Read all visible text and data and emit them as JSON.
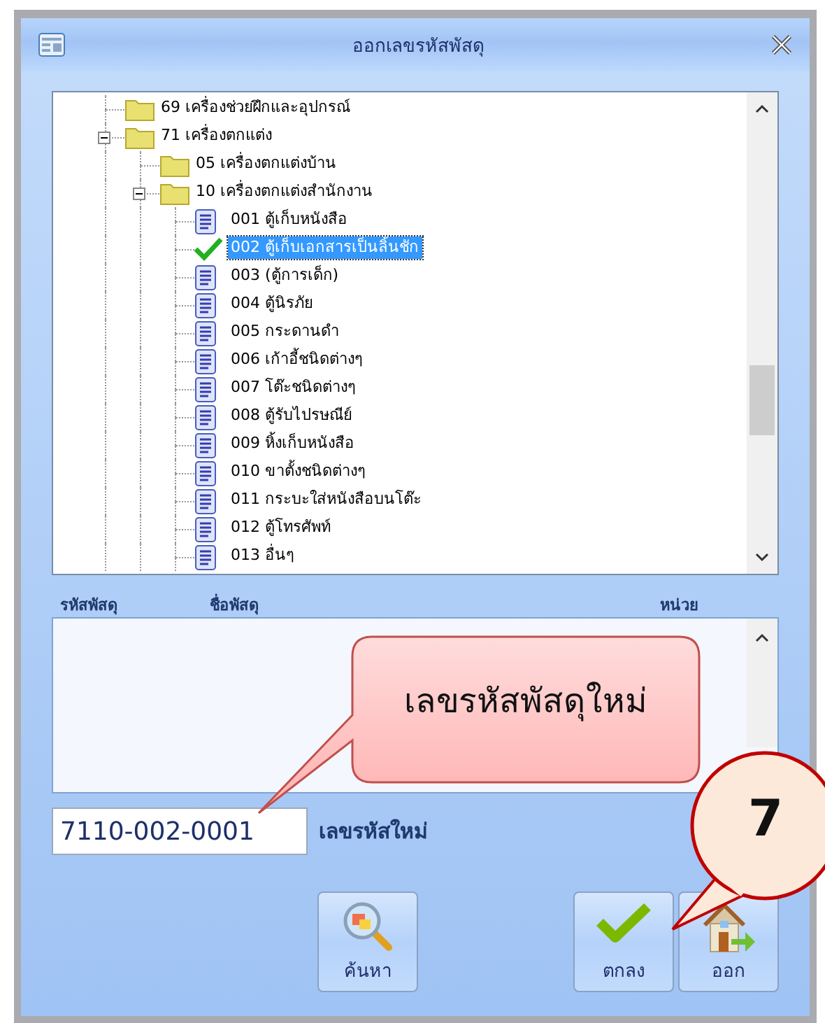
{
  "window": {
    "title": "ออกเลขรหัสพัสดุ"
  },
  "tree": [
    {
      "label": "69 เครื่องช่วยฝึกและอุปกรณ์",
      "kind": "folder",
      "selected": false
    },
    {
      "label": "71 เครื่องตกแต่ง",
      "kind": "folder",
      "selected": false,
      "expanded": true,
      "children": [
        {
          "label": "05 เครื่องตกแต่งบ้าน",
          "kind": "folder",
          "selected": false
        },
        {
          "label": "10 เครื่องตกแต่งสำนักงาน",
          "kind": "folder",
          "selected": false,
          "expanded": true,
          "children": [
            {
              "label": "001 ตู้เก็บหนังสือ",
              "kind": "file",
              "selected": false
            },
            {
              "label": "002 ตู้เก็บเอกสารเป็นลิ้นชัก",
              "kind": "check",
              "selected": true
            },
            {
              "label": "003 (ตู้การเด็ก)",
              "kind": "file",
              "selected": false
            },
            {
              "label": "004 ตู้นิรภัย",
              "kind": "file",
              "selected": false
            },
            {
              "label": "005 กระดานดำ",
              "kind": "file",
              "selected": false
            },
            {
              "label": "006 เก้าอี้ชนิดต่างๆ",
              "kind": "file",
              "selected": false
            },
            {
              "label": "007 โต๊ะชนิดต่างๆ",
              "kind": "file",
              "selected": false
            },
            {
              "label": "008 ตู้รับไปรษณีย์",
              "kind": "file",
              "selected": false
            },
            {
              "label": "009 หิ้งเก็บหนังสือ",
              "kind": "file",
              "selected": false
            },
            {
              "label": "010 ขาตั้งชนิดต่างๆ",
              "kind": "file",
              "selected": false
            },
            {
              "label": "011 กระบะใส่หนังสือบนโต๊ะ",
              "kind": "file",
              "selected": false
            },
            {
              "label": "012 ตู้โทรศัพท์",
              "kind": "file",
              "selected": false
            },
            {
              "label": "013 อื่นๆ",
              "kind": "file",
              "selected": false
            }
          ]
        }
      ]
    }
  ],
  "columns": [
    "รหัสพัสดุ",
    "ชื่อพัสดุ",
    "หน่วย"
  ],
  "code_field": {
    "value": "7110-002-0001",
    "label": "เลขรหัสใหม่"
  },
  "buttons": [
    {
      "label": "ค้นหา",
      "kind": "search"
    },
    {
      "label": "ตกลง",
      "kind": "ok"
    },
    {
      "label": "ออก",
      "kind": "exit"
    }
  ],
  "callouts": [
    {
      "text": "เลขรหัสพัสดุใหม่",
      "kind": "bubble"
    },
    {
      "text": "7",
      "kind": "circle"
    }
  ]
}
